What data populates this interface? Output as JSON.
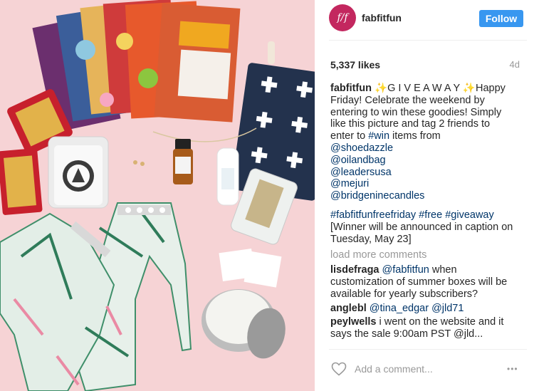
{
  "post": {
    "username": "fabfitfun",
    "avatar_text": "f/f",
    "follow_label": "Follow",
    "likes": "5,337 likes",
    "age": "4d"
  },
  "caption": {
    "user": "fabfitfun",
    "line1_text": " ✨G I V E A W A Y ✨Happy",
    "line2": "Friday! Celebrate the weekend by",
    "line3": "entering to win these goodies! Simply",
    "line4": "like this picture and tag 2 friends to",
    "line5_text": "enter to ",
    "line5_tag": "#win",
    "line5_rest": " items from",
    "mentions": [
      "@shoedazzle",
      "@oilandbag",
      "@leadersusa",
      "@mejuri",
      "@bridgeninecandles"
    ],
    "hashtag1": "#fabfitfunfreefriday",
    "hashtag2": "#free",
    "hashtag3": "#giveaway",
    "note1": "[Winner will be announced in caption on",
    "note2": "Tuesday, May 23]"
  },
  "load_more": "load more comments",
  "comments": [
    {
      "user": "lisdefraga",
      "mention": "@fabfitfun",
      "rest": " when",
      "line2": "customization of summer boxes will be",
      "line3": "available for yearly subscribers?"
    },
    {
      "user": "anglebl",
      "mention1": "@tina_edgar",
      "mention2": "@jld71"
    },
    {
      "user": "peylwells",
      "text": " i went on the website and it",
      "line2": "says the sale 9:00am PST @jld..."
    }
  ],
  "comment_box": {
    "placeholder": "Add a comment...",
    "more_icon": "•••"
  },
  "icons": {
    "like": "heart-outline-icon",
    "more": "more-options-icon"
  },
  "colors": {
    "follow_button": "#3897f0",
    "link": "#003569",
    "avatar": "#c3275f",
    "muted": "#999999",
    "photo_bg": "#f6d3d5"
  }
}
